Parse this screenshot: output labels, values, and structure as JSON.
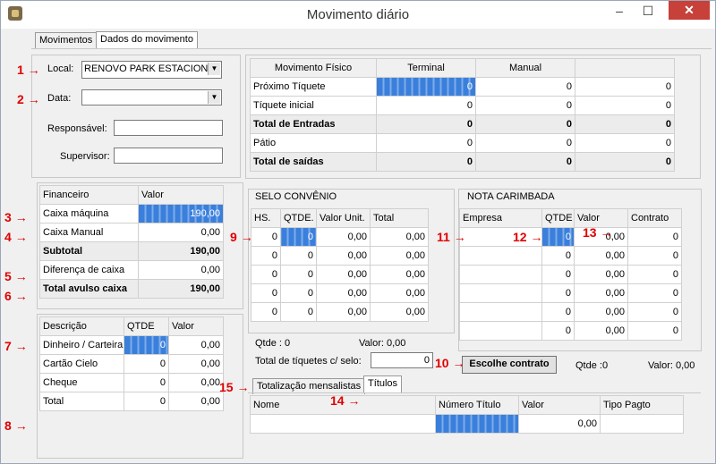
{
  "window": {
    "title": "Movimento diário",
    "minimize": "–",
    "maximize": "☐",
    "close": "✕"
  },
  "tabs": [
    "Movimentos",
    "Dados do movimento"
  ],
  "form": {
    "local_label": "Local:",
    "local_value": "RENOVO PARK ESTACIONA",
    "data_label": "Data:",
    "data_value": "",
    "responsavel_label": "Responsável:",
    "supervisor_label": "Supervisor:"
  },
  "movimento": {
    "headers": [
      "Movimento Físico",
      "Terminal",
      "Manual",
      ""
    ],
    "rows": [
      {
        "label": "Próximo Tíquete",
        "terminal": "0",
        "manual": "0",
        "extra": "0"
      },
      {
        "label": "Tíquete inicial",
        "terminal": "0",
        "manual": "0",
        "extra": "0"
      },
      {
        "label": "Total de Entradas",
        "terminal": "0",
        "manual": "0",
        "extra": "0"
      },
      {
        "label": "Pátio",
        "terminal": "0",
        "manual": "0",
        "extra": "0"
      },
      {
        "label": "Total de saídas",
        "terminal": "0",
        "manual": "0",
        "extra": "0"
      }
    ]
  },
  "financeiro": {
    "headers": [
      "Financeiro",
      "Valor"
    ],
    "rows": [
      {
        "label": "Caixa máquina",
        "value": "190,00"
      },
      {
        "label": "Caixa Manual",
        "value": "0,00"
      },
      {
        "label": "Subtotal",
        "value": "190,00"
      },
      {
        "label": "Diferença de caixa",
        "value": "0,00"
      },
      {
        "label": "Total avulso caixa",
        "value": "190,00"
      }
    ]
  },
  "pagamentos": {
    "headers": [
      "Descrição",
      "QTDE",
      "Valor"
    ],
    "rows": [
      {
        "label": "Dinheiro / Carteira",
        "qtde": "0",
        "value": "0,00"
      },
      {
        "label": "Cartão Cielo",
        "qtde": "0",
        "value": "0,00"
      },
      {
        "label": "Cheque",
        "qtde": "0",
        "value": "0,00"
      },
      {
        "label": "Total",
        "qtde": "0",
        "value": "0,00"
      }
    ]
  },
  "selo": {
    "title": "SELO CONVÊNIO",
    "headers": [
      "HS.",
      "QTDE.",
      "Valor Unit.",
      "Total"
    ],
    "rows": [
      {
        "hs": "0",
        "qtde": "0",
        "unit": "0,00",
        "total": "0,00"
      },
      {
        "hs": "0",
        "qtde": "0",
        "unit": "0,00",
        "total": "0,00"
      },
      {
        "hs": "0",
        "qtde": "0",
        "unit": "0,00",
        "total": "0,00"
      },
      {
        "hs": "0",
        "qtde": "0",
        "unit": "0,00",
        "total": "0,00"
      },
      {
        "hs": "0",
        "qtde": "0",
        "unit": "0,00",
        "total": "0,00"
      }
    ],
    "qtde_label": "Qtde : 0",
    "valor_label": "Valor: 0,00",
    "tiquetes_label": "Total de tíquetes c/ selo:",
    "tiquetes_value": "0"
  },
  "nota": {
    "title": "NOTA CARIMBADA",
    "headers": [
      "Empresa",
      "QTDE",
      "Valor",
      "Contrato"
    ],
    "rows": [
      {
        "empresa": "",
        "qtde": "0",
        "valor": "0,00",
        "contrato": "0"
      },
      {
        "empresa": "",
        "qtde": "0",
        "valor": "0,00",
        "contrato": "0"
      },
      {
        "empresa": "",
        "qtde": "0",
        "valor": "0,00",
        "contrato": "0"
      },
      {
        "empresa": "",
        "qtde": "0",
        "valor": "0,00",
        "contrato": "0"
      },
      {
        "empresa": "",
        "qtde": "0",
        "valor": "0,00",
        "contrato": "0"
      },
      {
        "empresa": "",
        "qtde": "0",
        "valor": "0,00",
        "contrato": "0"
      }
    ],
    "button": "Escolhe contrato",
    "qtde_label": "Qtde :0",
    "valor_label": "Valor: 0,00"
  },
  "bottom_tabs": [
    "Totalização mensalistas",
    "Títulos"
  ],
  "titulos": {
    "headers": [
      "Nome",
      "Número Título",
      "Valor",
      "Tipo Pagto"
    ],
    "row": {
      "nome": "",
      "numero": "",
      "valor": "0,00",
      "tipo": ""
    }
  },
  "annotations": [
    "1",
    "2",
    "3",
    "4",
    "5",
    "6",
    "7",
    "8",
    "9",
    "10",
    "11",
    "12",
    "13",
    "14",
    "15"
  ],
  "arrow": "→"
}
